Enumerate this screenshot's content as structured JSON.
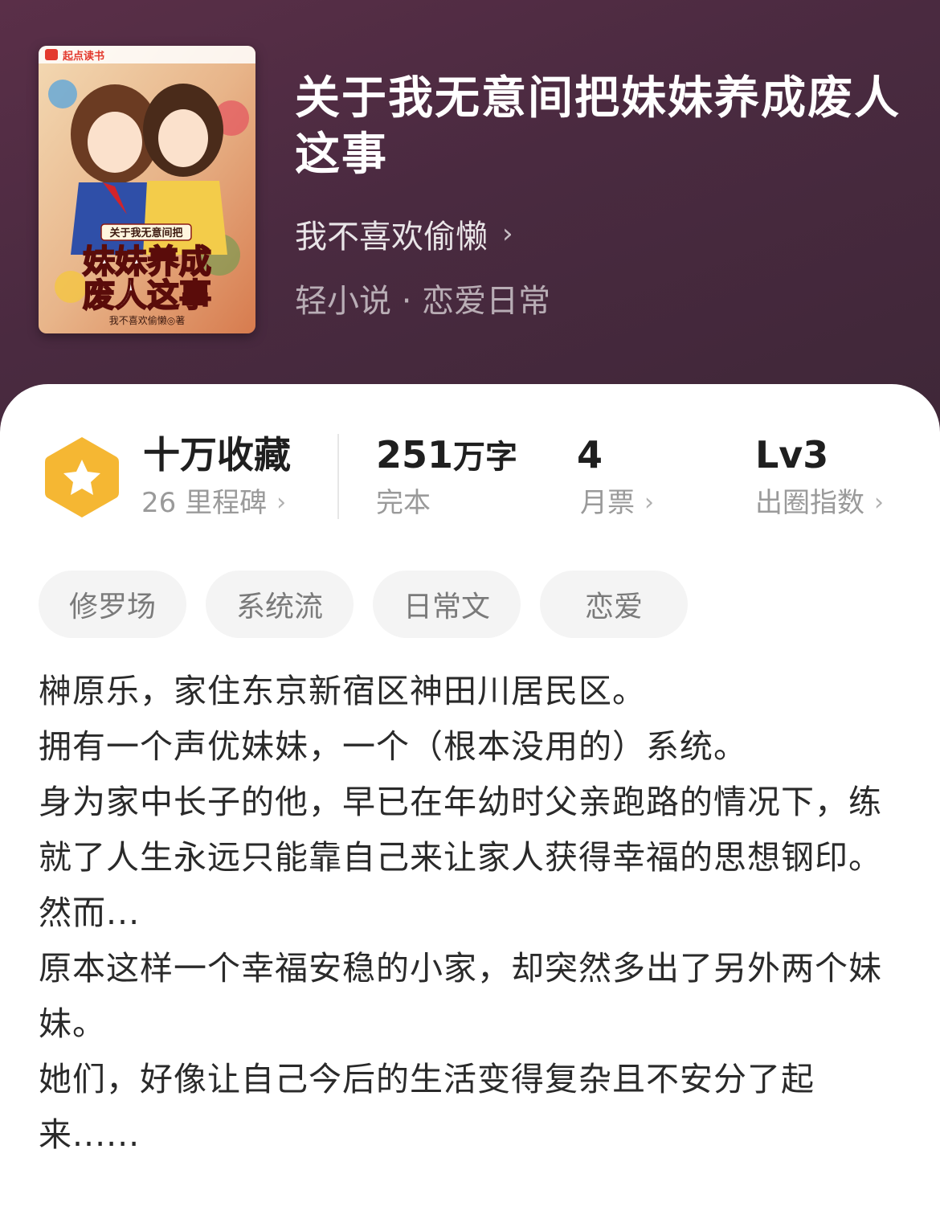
{
  "book": {
    "title": "关于我无意间把妹妹养成废人这事",
    "author": "我不喜欢偷懒",
    "genre": "轻小说 · 恋爱日常"
  },
  "cover": {
    "brand": "起点读书",
    "subtitle": "关于我无意间把",
    "title_line1": "妹妹养成",
    "title_line2": "废人这事",
    "author_credit": "我不喜欢偷懒◎著"
  },
  "stats": {
    "collection": {
      "value": "十万收藏",
      "sub": "26 里程碑"
    },
    "words": {
      "value": "251",
      "unit": "万字",
      "sub": "完本"
    },
    "tickets": {
      "value": "4",
      "sub": "月票"
    },
    "index": {
      "value": "Lv3",
      "sub": "出圈指数"
    }
  },
  "tags": [
    "修罗场",
    "系统流",
    "日常文",
    "恋爱"
  ],
  "synopsis": [
    "榊原乐，家住东京新宿区神田川居民区。",
    "拥有一个声优妹妹，一个（根本没用的）系统。",
    "身为家中长子的他，早已在年幼时父亲跑路的情况下，练就了人生永远只能靠自己来让家人获得幸福的思想钢印。",
    "然而...",
    "原本这样一个幸福安稳的小家，却突然多出了另外两个妹妹。",
    "她们，好像让自己今后的生活变得复杂且不安分了起来......"
  ],
  "colors": {
    "header_bg": "#4a2a40",
    "badge": "#f5b733",
    "tag_bg": "#f4f4f4"
  },
  "icons": {
    "badge": "star-hexagon-icon",
    "chevron": "chevron-right-icon"
  }
}
